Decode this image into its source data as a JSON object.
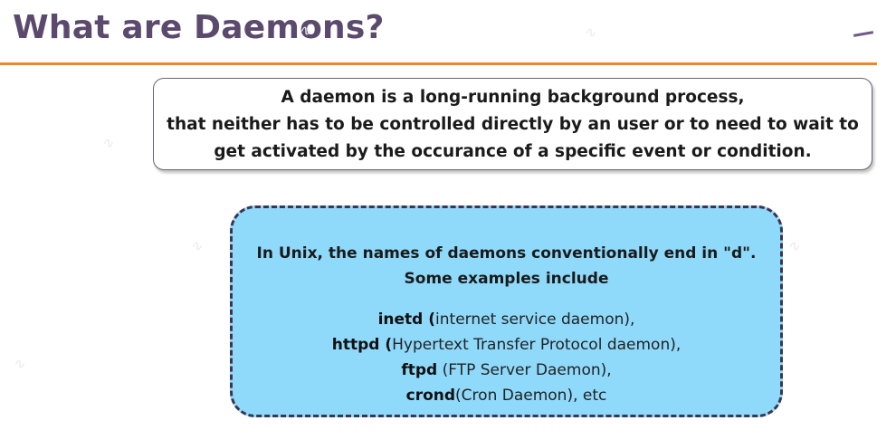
{
  "slide": {
    "title": "What are Daemons?"
  },
  "definition": {
    "lines": [
      "A daemon is a long-running background process,",
      "that neither has to be controlled directly by an user or to need to wait to",
      "get activated by the occurance of a specific event or condition."
    ]
  },
  "examples": {
    "intro_lines": [
      "In Unix, the names of daemons conventionally end in \"d\".",
      "Some examples include"
    ],
    "items": [
      {
        "name": "inetd",
        "open": " (",
        "desc": "internet service daemon),"
      },
      {
        "name": "httpd",
        "open": " (",
        "desc": "Hypertext Transfer Protocol daemon),"
      },
      {
        "name": "ftpd",
        "open": " ",
        "desc": "(FTP Server Daemon),"
      },
      {
        "name": "crond",
        "open": "",
        "desc": "(Cron Daemon), etc"
      }
    ]
  },
  "colors": {
    "title": "#5b4a6e",
    "rule": "#e98a2a",
    "examples_fill": "#8fd9fb",
    "examples_border": "#3c3552"
  }
}
